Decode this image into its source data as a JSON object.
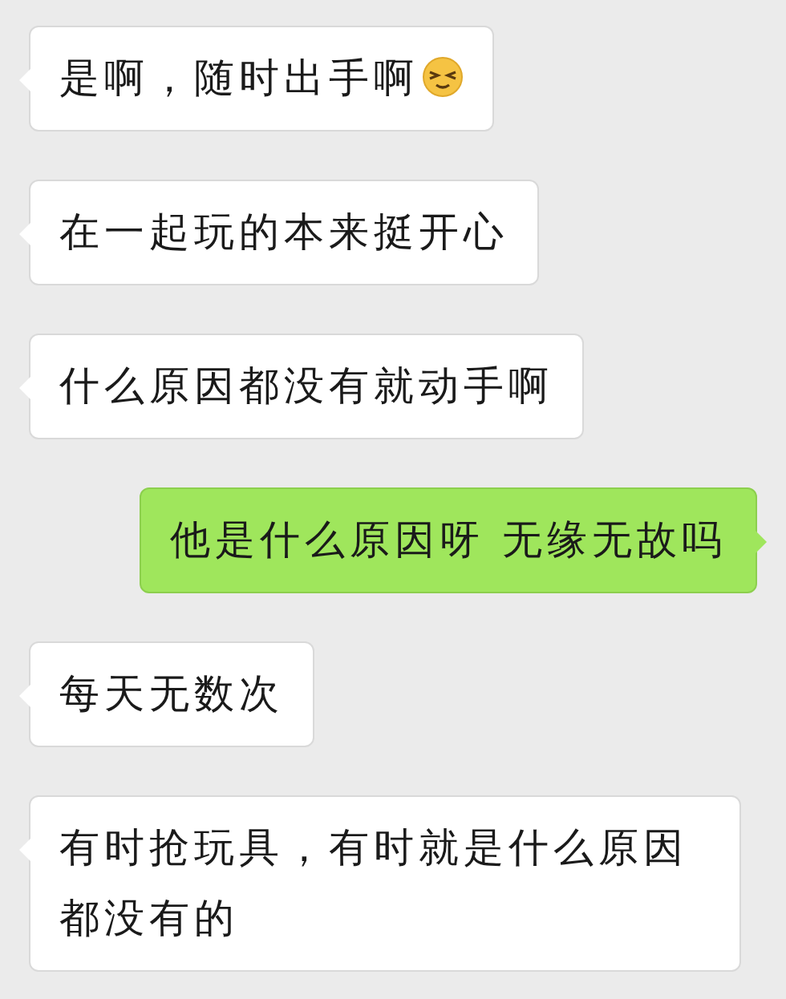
{
  "messages": [
    {
      "kind": "incoming",
      "text": "是啊，随时出手啊",
      "emoji": true
    },
    {
      "kind": "incoming",
      "text": "在一起玩的本来挺开心"
    },
    {
      "kind": "incoming",
      "text": "什么原因都没有就动手啊"
    },
    {
      "kind": "outgoing",
      "text": "他是什么原因呀 无缘无故吗"
    },
    {
      "kind": "incoming",
      "text": "每天无数次"
    },
    {
      "kind": "incoming",
      "text": "有时抢玩具，有时就是什么原因都没有的"
    }
  ]
}
